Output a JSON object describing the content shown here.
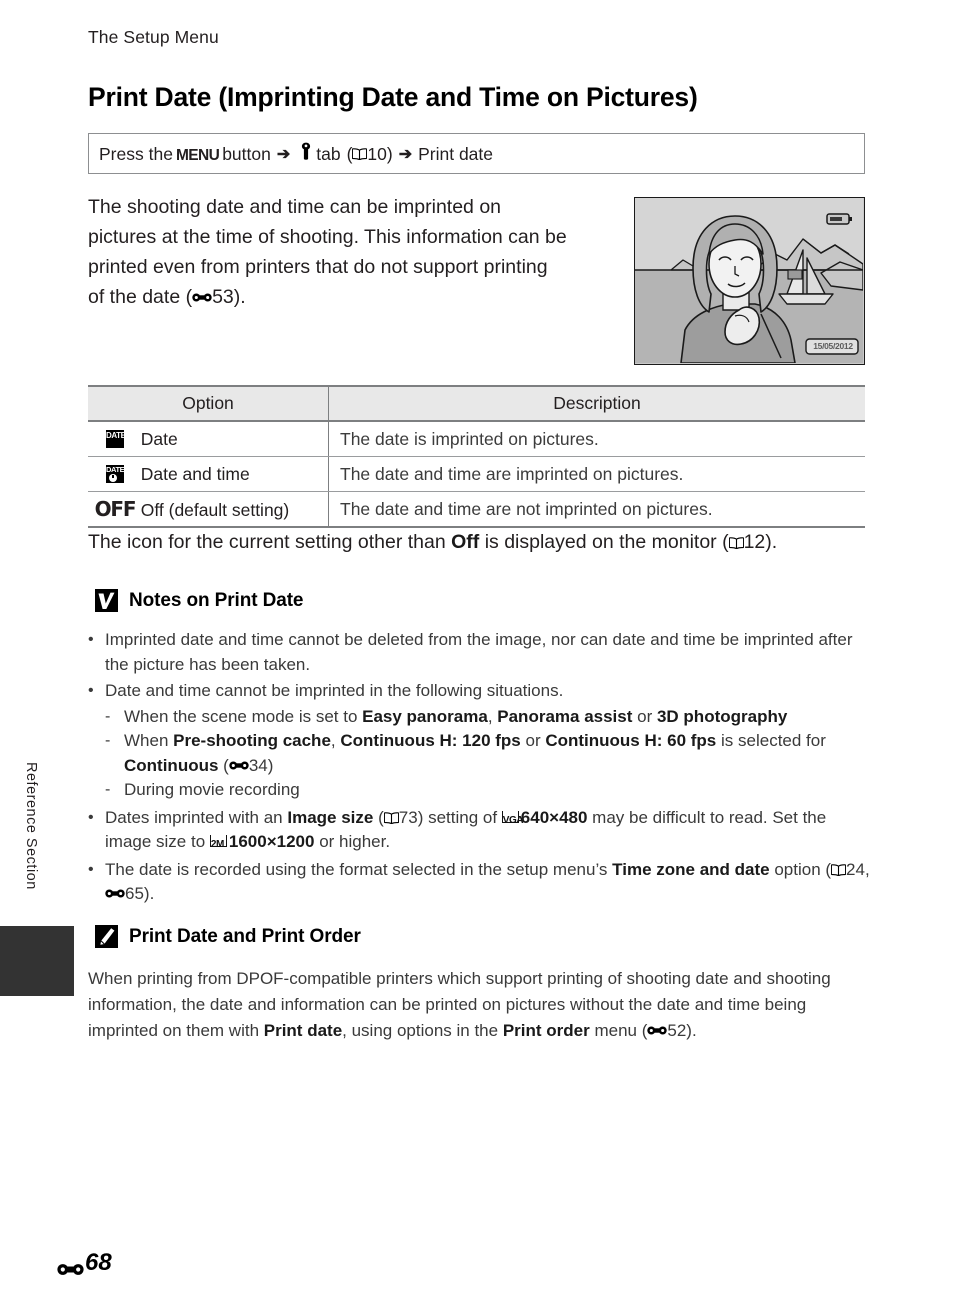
{
  "header": {
    "running_head": "The Setup Menu",
    "page_title": "Print Date (Imprinting Date and Time on Pictures)"
  },
  "instruction": {
    "press_the": "Press the",
    "menu_label": "MENU",
    "button_word": "button",
    "arrow": "➔",
    "wrench_icon": "wrench-icon",
    "tab_word": "tab",
    "open_paren": "(",
    "book_icon": "book-icon",
    "page_ref": "10",
    "close_paren": ")",
    "arrow2": "➔",
    "destination": "Print date"
  },
  "intro": {
    "line1": "The shooting date and time can be imprinted on",
    "line2": "pictures at the time of shooting. This information can be",
    "line3": "printed even from printers that do not support printing",
    "line4_pre": "of the date (",
    "line4_ref": "53",
    "line4_post": ")."
  },
  "camera_shot": {
    "alt": "camera-monitor-illustration",
    "date_stamp": "15/05/2012",
    "battery_icon": "battery-icon"
  },
  "table": {
    "columns": [
      "Option",
      "Description"
    ],
    "rows": [
      {
        "icon": "date-badge-icon",
        "icon_text": "DATE",
        "option": "Date",
        "description": "The date is imprinted on pictures."
      },
      {
        "icon": "date-time-badge-icon",
        "icon_text": "DATE",
        "option": "Date and time",
        "description": "The date and time are imprinted on pictures."
      },
      {
        "icon": "off-icon",
        "icon_text": "OFF",
        "option": "Off (default setting)",
        "description": "The date and time are not imprinted on pictures."
      }
    ]
  },
  "after_table": {
    "pre": "The icon for the current setting other than ",
    "bold": "Off",
    "mid": " is displayed on the monitor (",
    "ref": "12",
    "post": ")."
  },
  "notes": {
    "title": "Notes on Print Date",
    "icon": "caution-check-icon",
    "bullets": [
      {
        "text": "Imprinted date and time cannot be deleted from the image, nor can date and time be imprinted after the picture has been taken."
      },
      {
        "text": "Date and time cannot be imprinted in the following situations.",
        "sub": [
          {
            "pre": "When the scene mode is set to ",
            "b1": "Easy panorama",
            "sep1": ",  ",
            "b2": "Panorama assist",
            "sep2": " or ",
            "b3": "3D photography",
            "post": ""
          },
          {
            "pre": "When ",
            "b1": "Pre-shooting cache",
            "sep1": ", ",
            "b2": "Continuous H: 120 fps",
            "sep2": " or ",
            "b3": "Continuous H: 60 fps",
            "post": " is selected for ",
            "b4": "Continuous",
            "ref_open": " (",
            "ref": "34",
            "ref_close": ")"
          },
          {
            "pre": "During movie recording"
          }
        ]
      },
      {
        "pre": "Dates imprinted with an ",
        "b1": "Image size",
        "ref_open": " (",
        "ref1": "73",
        "ref_close": ") setting of ",
        "glyph1": "VGA",
        "b2": "640×480",
        "mid": " may be difficult to read. Set the image size to ",
        "glyph2": "2M",
        "b3": "1600×1200",
        "post": " or higher."
      },
      {
        "pre": "The date is recorded using the format selected in the setup menu’s ",
        "b1": "Time zone and date",
        "post": " option (",
        "ref_book": "24",
        "comma": ", ",
        "ref_e": "65",
        "end": ")."
      }
    ]
  },
  "tip": {
    "title": "Print Date and Print Order",
    "icon": "pencil-icon",
    "body": {
      "part1": "When printing from DPOF-compatible printers which support printing of shooting date and shooting information, the date and information can be printed on pictures without the date and time being imprinted on them with ",
      "b1": "Print date",
      "part2": ", using options in the ",
      "b2": "Print order",
      "part3": " menu (",
      "ref": "52",
      "part4": ")."
    }
  },
  "sidebar": {
    "vertical_label": "Reference Section",
    "tab": "section-tab"
  },
  "footer": {
    "ref_icon": "reference-section-icon",
    "page_number": "68"
  },
  "colors": {
    "text": "#231f20",
    "rule": "#7d7f81",
    "header_fill": "#e8e8e8",
    "tab_dark": "#333333"
  }
}
